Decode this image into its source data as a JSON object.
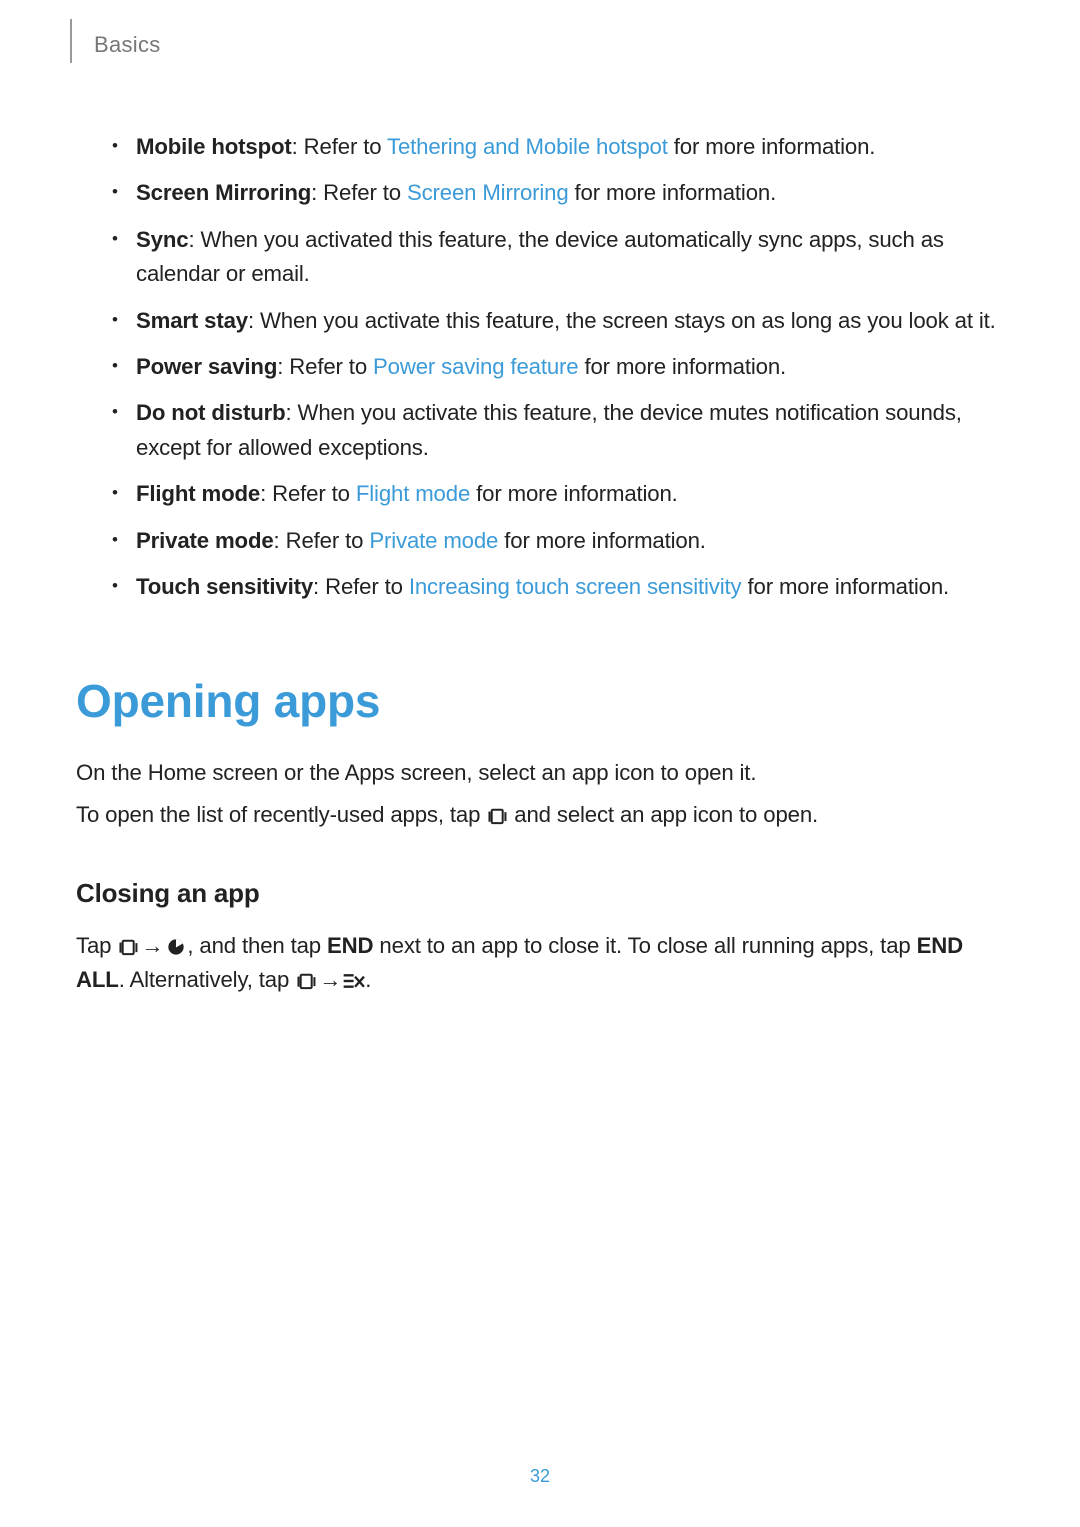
{
  "header": {
    "section": "Basics"
  },
  "bullets": [
    {
      "title": "Mobile hotspot",
      "pre": ": Refer to ",
      "link": "Tethering and Mobile hotspot",
      "post": " for more information."
    },
    {
      "title": "Screen Mirroring",
      "pre": ": Refer to ",
      "link": "Screen Mirroring",
      "post": " for more information."
    },
    {
      "title": "Sync",
      "text_after_title": ": When you activated this feature, the device automatically sync apps, such as calendar or email."
    },
    {
      "title": "Smart stay",
      "text_after_title": ": When you activate this feature, the screen stays on as long as you look at it."
    },
    {
      "title": "Power saving",
      "pre": ": Refer to ",
      "link": "Power saving feature",
      "post": " for more information."
    },
    {
      "title": "Do not disturb",
      "text_after_title": ": When you activate this feature, the device mutes notification sounds, except for allowed exceptions."
    },
    {
      "title": "Flight mode",
      "pre": ": Refer to ",
      "link": "Flight mode",
      "post": " for more information."
    },
    {
      "title": "Private mode",
      "pre": ": Refer to ",
      "link": "Private mode",
      "post": " for more information."
    },
    {
      "title": "Touch sensitivity",
      "pre": ": Refer to ",
      "link": "Increasing touch screen sensitivity",
      "post": " for more information."
    }
  ],
  "opening": {
    "title": "Opening apps",
    "p1": "On the Home screen or the Apps screen, select an app icon to open it.",
    "p2_pre": "To open the list of recently-used apps, tap ",
    "p2_post": " and select an app icon to open."
  },
  "closing": {
    "title": "Closing an app",
    "seg1": "Tap ",
    "arrow": " → ",
    "seg2": ", and then tap ",
    "end": "END",
    "seg3": " next to an app to close it. To close all running apps, tap ",
    "endall": "END ALL",
    "seg4": ". Alternatively, tap ",
    "seg5": "."
  },
  "page_number": "32"
}
